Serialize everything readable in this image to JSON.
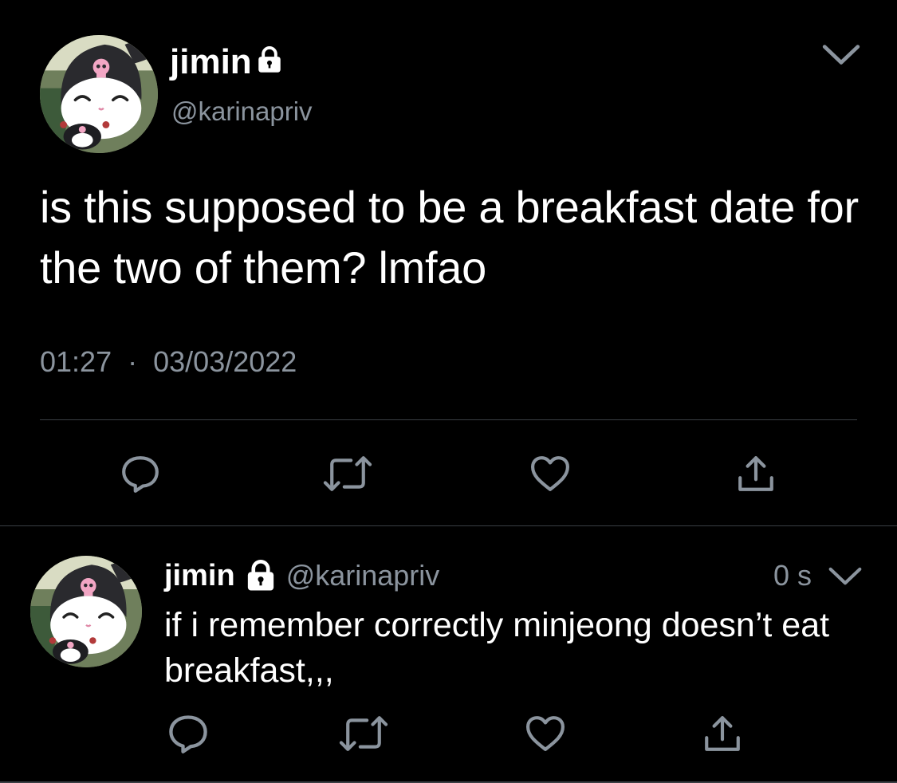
{
  "main_tweet": {
    "display_name": "jimin",
    "handle": "@karinapriv",
    "text": "is this supposed to be a breakfast date for the two of them? lmfao",
    "time": "01:27",
    "separator": "·",
    "date": "03/03/2022",
    "icons": {
      "lock": "lock-icon",
      "menu": "chevron-down-icon",
      "reply": "reply-icon",
      "retweet": "retweet-icon",
      "like": "heart-icon",
      "share": "share-icon"
    }
  },
  "reply_tweet": {
    "display_name": "jimin",
    "handle": "@karinapriv",
    "relative_time": "0 s",
    "text": "if i remember correctly minjeong doesn’t eat breakfast,,,",
    "icons": {
      "lock": "lock-icon",
      "menu": "chevron-down-icon",
      "reply": "reply-icon",
      "retweet": "retweet-icon",
      "like": "heart-icon",
      "share": "share-icon"
    }
  },
  "colors": {
    "background": "#000000",
    "primary_text": "#ffffff",
    "secondary_text": "#8b949e",
    "divider": "#3a3f44",
    "icon": "#8b949e"
  }
}
